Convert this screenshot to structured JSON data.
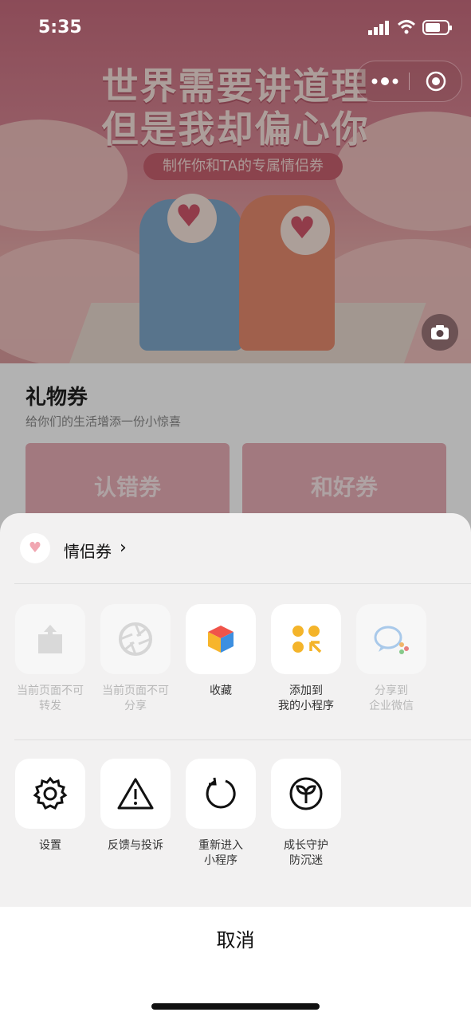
{
  "status_bar": {
    "time": "5:35"
  },
  "background": {
    "hero_line1": "世界需要讲道理",
    "hero_line2": "但是我却偏心你",
    "hero_pill": "制作你和TA的专属情侣券",
    "gift_title": "礼物券",
    "gift_subtitle": "给你们的生活增添一份小惊喜",
    "tickets": [
      "认错券",
      "和好券"
    ]
  },
  "sheet": {
    "app_name": "情侣券",
    "row1": [
      {
        "label": "当前页面不可\n转发",
        "icon": "share-out-icon",
        "disabled": true
      },
      {
        "label": "当前页面不可\n分享",
        "icon": "aperture-icon",
        "disabled": true
      },
      {
        "label": "收藏",
        "icon": "favorite-cube-icon",
        "disabled": false
      },
      {
        "label": "添加到\n我的小程序",
        "icon": "add-miniprogram-icon",
        "disabled": false
      },
      {
        "label": "分享到\n企业微信",
        "icon": "wecom-icon",
        "disabled": true
      }
    ],
    "row2": [
      {
        "label": "设置",
        "icon": "gear-icon"
      },
      {
        "label": "反馈与投诉",
        "icon": "warning-icon"
      },
      {
        "label": "重新进入\n小程序",
        "icon": "reload-icon"
      },
      {
        "label": "成长守护\n防沉迷",
        "icon": "sprout-icon"
      }
    ],
    "cancel": "取消"
  },
  "colors": {
    "accent_pink": "#e9aeb6",
    "sheet_bg": "#f2f1f1"
  }
}
